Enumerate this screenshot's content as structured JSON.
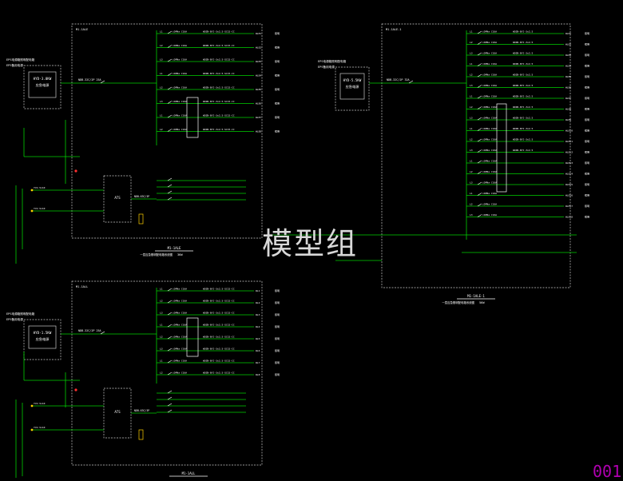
{
  "colors": {
    "background": "#000000",
    "wire": "#00d000",
    "text": "#ffffff",
    "frame": "#c8c8c8",
    "accent": "#ffd000",
    "red": "#ff3030",
    "magenta": "#b000b0"
  },
  "watermark": "模型组",
  "page_number": "001",
  "panels": [
    {
      "id": "A",
      "eps_label": "EPS电源箱照明配电箱",
      "eps_sub": "EPS备用电源",
      "eps_unit": "HYD-3.0KW",
      "eps_unit_sub": "应急电源",
      "header": "M1-1ALE",
      "caption": "M1-1ALE",
      "caption_sub": "一层应急照明配电箱系统图",
      "caption_kw": "3KW",
      "main_breaker": "NDB-32C/2P  25A",
      "in_cable": "YJV-5x10",
      "feeder_labels": [
        "WLE1",
        "WLE2",
        "WLE3",
        "WLE4",
        "WLE5",
        "WLE6",
        "WLE7",
        "WLE8"
      ],
      "side_labels": [
        "WDZN-BYJ-3x2.5-SC15-CC",
        "WDZN-BYJ-3x2.5-SC15-CC",
        "WDZN-BYJ-3x2.5-SC15-CC",
        "WDZN-BYJ-3x2.5-SC15-CC",
        "WDZN-BYJ-3x2.5-SC15-CC",
        "WDZN-BYJ-3x2.5-SC15-CC",
        "WDZN-BYJ-3x2.5-SC15-CC",
        "WDZN-BYJ-3x2.5-SC15-CC"
      ],
      "lower_breaker": "NDB-63C/3P",
      "ats": "ATS"
    },
    {
      "id": "B",
      "eps_label": "EPS电源箱照明配电箱",
      "eps_sub": "EPS备用电源",
      "eps_unit": "HYD-1.5KW",
      "eps_unit_sub": "应急电源",
      "header": "M1-1ALL",
      "caption": "M1-1ALL",
      "caption_sub": "一层照明配电箱系统图",
      "caption_kw": "",
      "main_breaker": "NDB-32C/2P  25A",
      "in_cable": "YJV-5x10",
      "feeder_labels": [
        "WL1",
        "WL2",
        "WL3",
        "WL4",
        "WL5",
        "WL6",
        "WL7",
        "WL8"
      ],
      "side_labels": [
        "WDZN-BYJ-3x2.5-SC15-CC",
        "WDZN-BYJ-3x2.5-SC15-CC",
        "WDZN-BYJ-3x2.5-SC15-CC",
        "WDZN-BYJ-3x2.5-SC15-CC",
        "WDZN-BYJ-3x2.5-SC15-CC",
        "WDZN-BYJ-3x2.5-SC15-CC",
        "WDZN-BYJ-3x2.5-SC15-CC",
        "WDZN-BYJ-3x2.5-SC15-CC"
      ],
      "lower_breaker": "NDB-63C/3P",
      "ats": "ATS"
    },
    {
      "id": "C",
      "eps_label": "EPS电源箱照明配电箱",
      "eps_sub": "EPS备用电源",
      "eps_unit": "HYD-5.5KW",
      "eps_unit_sub": "应急电源",
      "header": "M1-1ALE-1",
      "caption": "M1-1ALE-1",
      "caption_sub": "一层应急照明配电箱系统图",
      "caption_kw": "5KW",
      "main_breaker": "NDB-32C/2P  32A",
      "in_cable": "YJV-5x10",
      "feeder_labels": [
        "WLE1",
        "WLE2",
        "WLE3",
        "WLE4",
        "WLE5",
        "WLE6",
        "WLE7",
        "WLE8",
        "WLE9",
        "WLE10",
        "WLE11",
        "WLE12",
        "WLE13",
        "WLE14",
        "WLE15",
        "WLE16",
        "WLE17",
        "WLE18"
      ],
      "side_labels": [
        "WDZN-BYJ-3x2.5",
        "WDZN-BYJ-3x2.5",
        "WDZN-BYJ-3x2.5",
        "WDZN-BYJ-3x2.5",
        "WDZN-BYJ-3x2.5",
        "WDZN-BYJ-3x2.5",
        "WDZN-BYJ-3x2.5",
        "WDZN-BYJ-3x2.5",
        "WDZN-BYJ-3x2.5",
        "WDZN-BYJ-3x2.5",
        "WDZN-BYJ-3x2.5",
        "WDZN-BYJ-3x2.5"
      ],
      "lower_breaker": "SPN-32A/2P",
      "ats": ""
    }
  ]
}
